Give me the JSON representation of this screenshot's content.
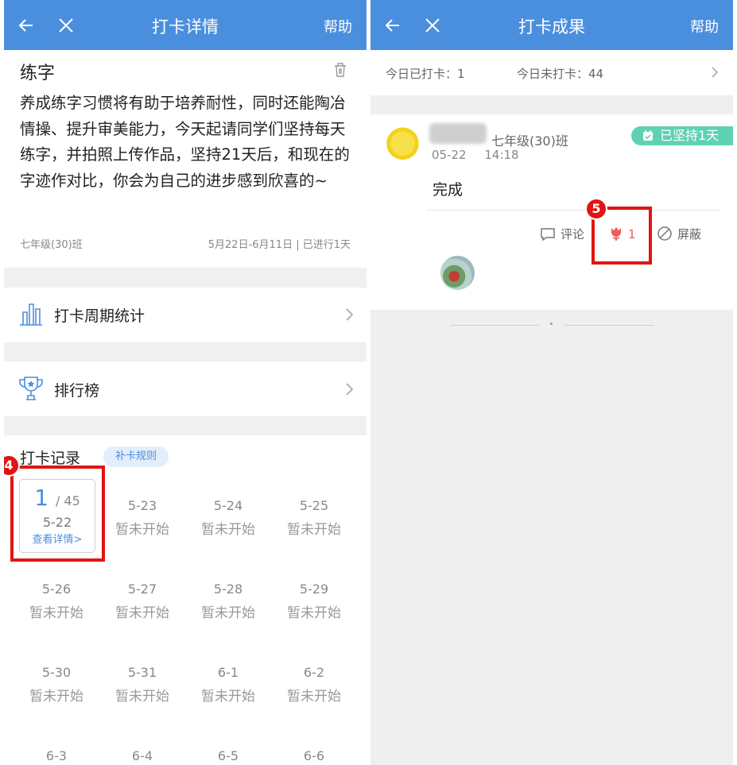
{
  "left": {
    "appbar": {
      "title": "打卡详情",
      "help": "帮助"
    },
    "task": {
      "title": "练字",
      "description": "养成练字习惯将有助于培养耐性，同时还能陶冶情操、提升审美能力，今天起请同学们坚持每天练字，并拍照上传作品，坚持21天后，和现在的字迹作对比，你会为自己的进步感到欣喜的~",
      "class_name": "七年级(30)班",
      "range": "5月22日-6月11日 | 已进行1天"
    },
    "menu": [
      {
        "label": "打卡周期统计",
        "icon": "bar-chart-icon"
      },
      {
        "label": "排行榜",
        "icon": "trophy-icon"
      }
    ],
    "records": {
      "title": "打卡记录",
      "rule_pill": "补卡规则",
      "first_card": {
        "count": "1",
        "total": "/ 45",
        "date": "5-22",
        "link": "查看详情>"
      },
      "days": [
        {
          "date": "5-23",
          "status": "暂未开始"
        },
        {
          "date": "5-24",
          "status": "暂未开始"
        },
        {
          "date": "5-25",
          "status": "暂未开始"
        },
        {
          "date": "5-26",
          "status": "暂未开始"
        },
        {
          "date": "5-27",
          "status": "暂未开始"
        },
        {
          "date": "5-28",
          "status": "暂未开始"
        },
        {
          "date": "5-29",
          "status": "暂未开始"
        },
        {
          "date": "5-30",
          "status": "暂未开始"
        },
        {
          "date": "5-31",
          "status": "暂未开始"
        },
        {
          "date": "6-1",
          "status": "暂未开始"
        },
        {
          "date": "6-2",
          "status": "暂未开始"
        },
        {
          "date": "6-3",
          "status": ""
        },
        {
          "date": "6-4",
          "status": ""
        },
        {
          "date": "6-5",
          "status": ""
        },
        {
          "date": "6-6",
          "status": ""
        }
      ]
    },
    "step_badge": "4"
  },
  "right": {
    "appbar": {
      "title": "打卡成果",
      "help": "帮助"
    },
    "stats": {
      "done": "今日已打卡：1",
      "not_done": "今日未打卡：44"
    },
    "post": {
      "class": "七年级(30)班",
      "date": "05-22",
      "time": "14:18",
      "streak": "已坚持1天",
      "content": "完成",
      "comment": "评论",
      "likes": "1",
      "block": "屏蔽"
    },
    "step_badge": "5"
  },
  "colors": {
    "header": "#4a8fde",
    "highlight": "#e01515",
    "streak": "#5fd2b3",
    "like": "#f05a5a"
  }
}
